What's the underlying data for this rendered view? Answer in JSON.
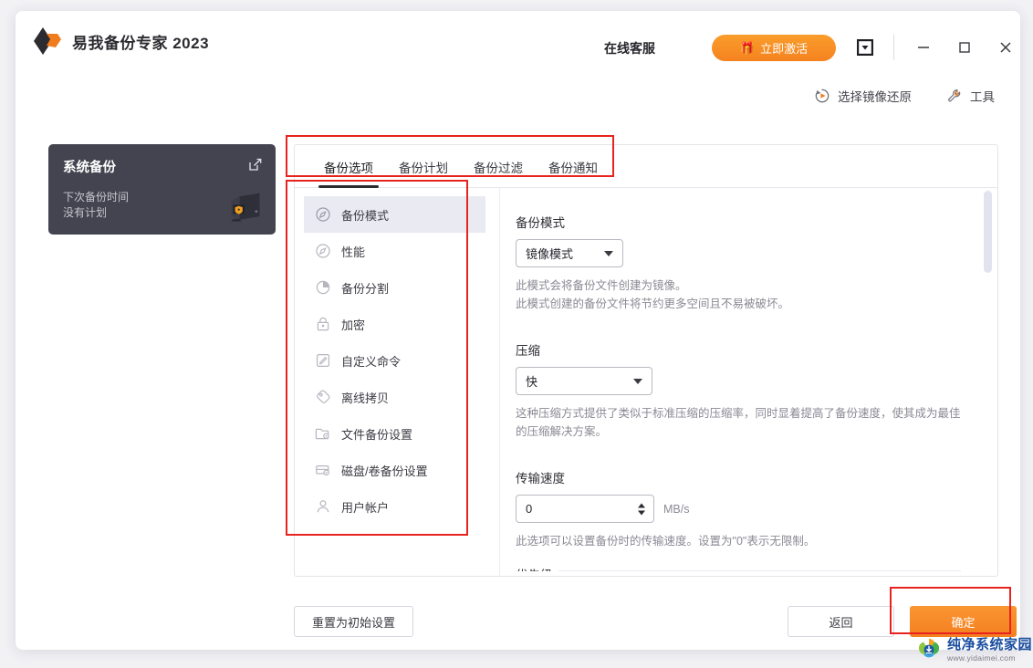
{
  "window": {
    "brand_title": "易我备份专家 2023",
    "logo_icon": "diamond-logo-icon"
  },
  "titlebar": {
    "support_label": "在线客服",
    "activate_label": "立即激活",
    "activate_icon": "gift-icon",
    "menu_icon": "caret-down-box-icon",
    "minimize_icon": "minimize-icon",
    "maximize_icon": "maximize-icon",
    "close_icon": "close-icon"
  },
  "toolbar": {
    "items": [
      {
        "label": "选择镜像还原",
        "icon": "image-restore-icon"
      },
      {
        "label": "工具",
        "icon": "wrench-icon"
      }
    ]
  },
  "job_card": {
    "title": "系统备份",
    "edit_icon": "edit-square-icon",
    "sub_line1": "下次备份时间",
    "sub_line2": "没有计划",
    "device_icon": "computer-shield-icon"
  },
  "panel": {
    "tabs": [
      {
        "label": "备份选项",
        "active": true
      },
      {
        "label": "备份计划",
        "active": false
      },
      {
        "label": "备份过滤",
        "active": false
      },
      {
        "label": "备份通知",
        "active": false
      }
    ],
    "side_items": [
      {
        "label": "备份模式",
        "icon": "gauge-icon",
        "active": true
      },
      {
        "label": "性能",
        "icon": "gauge-icon",
        "active": false
      },
      {
        "label": "备份分割",
        "icon": "pie-chart-icon",
        "active": false
      },
      {
        "label": "加密",
        "icon": "lock-icon",
        "active": false
      },
      {
        "label": "自定义命令",
        "icon": "pencil-square-icon",
        "active": false
      },
      {
        "label": "离线拷贝",
        "icon": "tag-icon",
        "active": false
      },
      {
        "label": "文件备份设置",
        "icon": "folder-gear-icon",
        "active": false
      },
      {
        "label": "磁盘/卷备份设置",
        "icon": "disk-gear-icon",
        "active": false
      },
      {
        "label": "用户帐户",
        "icon": "user-icon",
        "active": false
      }
    ],
    "content": {
      "backup_mode": {
        "label": "备份模式",
        "value": "镜像模式",
        "help_line1": "此模式会将备份文件创建为镜像。",
        "help_line2": "此模式创建的备份文件将节约更多空间且不易被破坏。"
      },
      "compression": {
        "label": "压缩",
        "value": "快",
        "help_line1": "这种压缩方式提供了类似于标准压缩的压缩率，同时显着提高了备份速度，使其成为最佳",
        "help_line2": "的压缩解决方案。"
      },
      "transfer_speed": {
        "label": "传输速度",
        "value": "0",
        "unit": "MB/s",
        "help_line1": "此选项可以设置备份时的传输速度。设置为\"0\"表示无限制。"
      },
      "next_section_label": "优先级"
    },
    "scrollbar_icon": "vertical-scrollbar"
  },
  "footer": {
    "reset_label": "重置为初始设置",
    "back_label": "返回",
    "ok_label": "确定"
  },
  "watermark": {
    "name": "纯净系统家园",
    "url": "www.yidaimei.com",
    "icon": "download-circle-logo-icon"
  },
  "colors": {
    "accent_orange": "#f58220",
    "dark_card": "#434450",
    "annotation_red": "#e8231f",
    "active_item_bg": "#e9eaf2"
  }
}
